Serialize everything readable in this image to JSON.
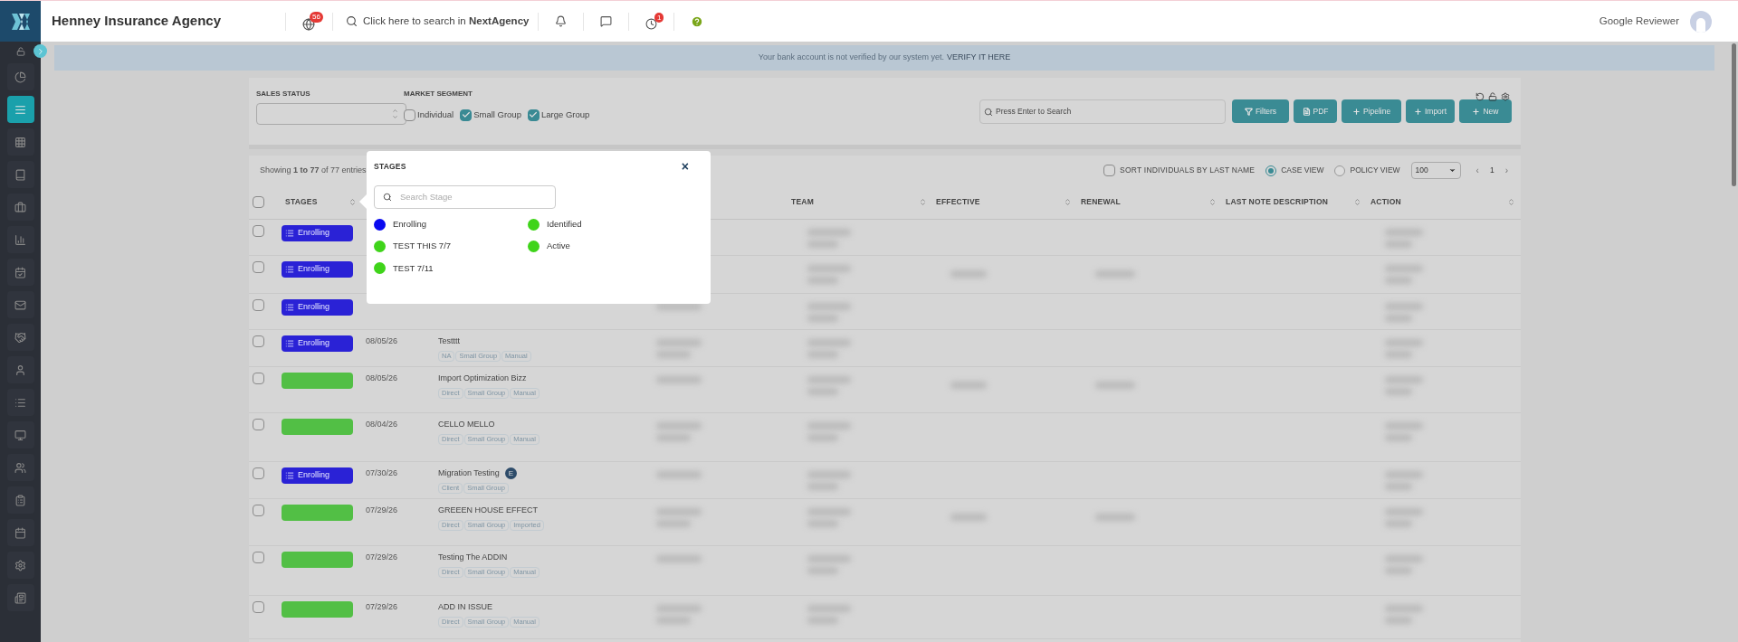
{
  "top_bar": {
    "title": "Henney Insurance Agency",
    "globe_badge": "56",
    "search": "Click here to search in **NextAgency**",
    "clock_badge": "1",
    "user": "Google Reviewer"
  },
  "sidebar": {
    "items": [
      {
        "selected": false
      },
      {
        "selected": true
      },
      {
        "selected": false
      },
      {
        "selected": false
      },
      {
        "selected": false
      },
      {
        "selected": false
      },
      {
        "selected": false
      },
      {
        "selected": false
      },
      {
        "selected": false
      },
      {
        "selected": false
      },
      {
        "selected": false
      },
      {
        "selected": false
      },
      {
        "selected": false
      },
      {
        "selected": false
      },
      {
        "selected": false
      },
      {
        "selected": false
      },
      {
        "selected": false
      }
    ]
  },
  "banner": {
    "text": "Your bank account is not verified by our system yet.",
    "link": "VERIFY IT HERE"
  },
  "filters": {
    "sales_status": {
      "label": "SALES STATUS"
    },
    "market_segment": {
      "label": "MARKET SEGMENT",
      "options": [
        {
          "label": "Individual",
          "checked": false
        },
        {
          "label": "Small Group",
          "checked": true
        },
        {
          "label": "Large Group",
          "checked": true
        }
      ]
    },
    "search": {
      "placeholder": "Press Enter to Search"
    },
    "buttons": [
      {
        "label": "Filters",
        "kind": "filter"
      },
      {
        "label": "PDF",
        "kind": "pdf"
      },
      {
        "label": "Pipeline",
        "kind": "plus"
      },
      {
        "label": "Import",
        "kind": "plus"
      },
      {
        "label": "New",
        "kind": "plus"
      }
    ]
  },
  "table": {
    "info": "Showing **1 to 77** of 77 entries",
    "sort_option": {
      "label": "SORT INDIVIDUALS BY LAST NAME",
      "checked": false
    },
    "views": [
      {
        "label": "CASE VIEW",
        "selected": true
      },
      {
        "label": "POLICY VIEW",
        "selected": false
      }
    ],
    "page_size": "100",
    "pagination": {
      "prev": "‹",
      "page": "1",
      "next": "›"
    },
    "select_all": {
      "checked": false
    },
    "columns": [
      "STAGES",
      "",
      "",
      "",
      "TEAM",
      "EFFECTIVE",
      "RENEWAL",
      "LAST NOTE DESCRIPTION",
      "ACTION"
    ],
    "rows": [
      {
        "checked": false,
        "stage": {
          "label": "Enrolling",
          "color": "#2a22d6"
        }
      },
      {
        "checked": false,
        "stage": {
          "label": "Enrolling",
          "color": "#2a22d6"
        }
      },
      {
        "checked": false,
        "stage": {
          "label": "Enrolling",
          "color": "#2a22d6"
        }
      },
      {
        "checked": false,
        "stage": {
          "label": "Enrolling",
          "color": "#2a22d6"
        },
        "date": "08/05/26",
        "name": "Testttt",
        "tags": [
          "NA",
          "Small Group",
          "Manual"
        ]
      },
      {
        "checked": false,
        "stage": {
          "color": "#52bf45"
        },
        "date": "08/05/26",
        "name": "Import Optimization Bizz",
        "tags": [
          "Direct",
          "Small Group",
          "Manual"
        ]
      },
      {
        "checked": false,
        "stage": {
          "color": "#52bf45"
        },
        "date": "08/04/26",
        "name": "CELLO MELLO",
        "tags": [
          "Direct",
          "Small Group",
          "Manual"
        ]
      },
      {
        "checked": false,
        "stage": {
          "label": "Enrolling",
          "color": "#2a22d6"
        },
        "date": "07/30/26",
        "name": "Migration Testing",
        "badge": "E",
        "tags": [
          "Client",
          "Small Group"
        ]
      },
      {
        "checked": false,
        "stage": {
          "color": "#52bf45"
        },
        "date": "07/29/26",
        "name": "GREEEN HOUSE EFFECT",
        "tags": [
          "Direct",
          "Small Group",
          "Imported"
        ]
      },
      {
        "checked": false,
        "stage": {
          "color": "#52bf45"
        },
        "date": "07/29/26",
        "name": "Testing The ADDIN",
        "tags": [
          "Direct",
          "Small Group",
          "Manual"
        ]
      },
      {
        "checked": false,
        "stage": {
          "color": "#52bf45"
        },
        "date": "07/29/26",
        "name": "ADD IN ISSUE",
        "tags": [
          "Direct",
          "Small Group",
          "Manual"
        ]
      }
    ]
  },
  "stages_popup": {
    "title": "STAGES",
    "close": "×",
    "search": {
      "placeholder": "Search Stage"
    },
    "options": [
      {
        "label": "Enrolling",
        "color": "#0a0af0"
      },
      {
        "label": "Identified",
        "color": "#3fd41a"
      },
      {
        "label": "TEST THIS 7/7",
        "color": "#3fd41a"
      },
      {
        "label": "Active",
        "color": "#3fd41a"
      },
      {
        "label": "TEST 7/11",
        "color": "#3fd41a"
      }
    ]
  }
}
